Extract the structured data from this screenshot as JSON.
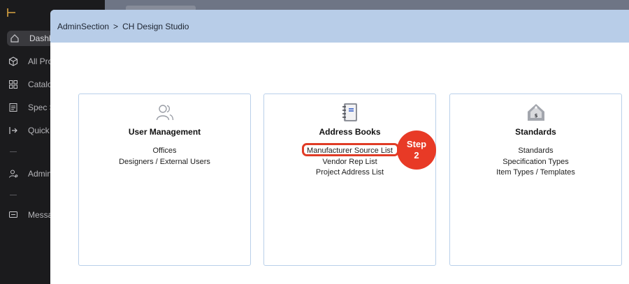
{
  "sidebar": {
    "items": [
      {
        "label": "Dashb",
        "icon": "home-icon"
      },
      {
        "label": "All Pro",
        "icon": "cube-icon"
      },
      {
        "label": "Catalo",
        "icon": "grid-icon"
      },
      {
        "label": "Spec S",
        "icon": "document-icon"
      },
      {
        "label": "Quick",
        "icon": "arrow-right-bar-icon"
      },
      {
        "label": "Admin",
        "icon": "user-gear-icon"
      },
      {
        "label": "Messa",
        "icon": "message-icon"
      }
    ]
  },
  "modal": {
    "breadcrumb": {
      "root": "AdminSection",
      "separator": ">",
      "current": "CH Design Studio"
    }
  },
  "cards": [
    {
      "title": "User Management",
      "icon": "users-icon",
      "links": [
        "Offices",
        "Designers / External Users"
      ]
    },
    {
      "title": "Address Books",
      "icon": "notebook-icon",
      "links": [
        "Manufacturer Source List",
        "Vendor Rep List",
        "Project Address List"
      ]
    },
    {
      "title": "Standards",
      "icon": "price-tag-icon",
      "links": [
        "Standards",
        "Specification Types",
        "Item Types / Templates"
      ]
    }
  ],
  "annotation": {
    "step_word": "Step",
    "step_number": "2",
    "color": "#e83a26"
  }
}
